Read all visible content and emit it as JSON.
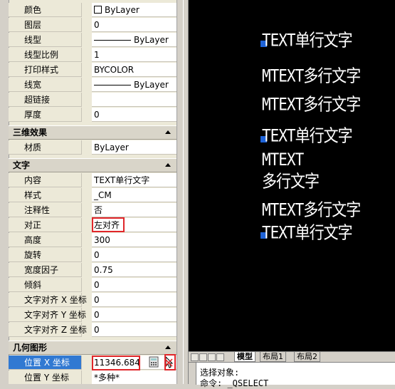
{
  "properties": {
    "general_rows": [
      {
        "label": "颜色",
        "value": "ByLayer"
      },
      {
        "label": "图层",
        "value": "0"
      },
      {
        "label": "线型",
        "value": "ByLayer"
      },
      {
        "label": "线型比例",
        "value": "1"
      },
      {
        "label": "打印样式",
        "value": "BYCOLOR"
      },
      {
        "label": "线宽",
        "value": "ByLayer"
      },
      {
        "label": "超链接",
        "value": ""
      },
      {
        "label": "厚度",
        "value": "0"
      }
    ],
    "section_3d": "三维效果",
    "rows_3d": [
      {
        "label": "材质",
        "value": "ByLayer"
      }
    ],
    "section_text": "文字",
    "text_rows": [
      {
        "label": "内容",
        "value": "TEXT单行文字"
      },
      {
        "label": "样式",
        "value": "_CM"
      },
      {
        "label": "注释性",
        "value": "否"
      },
      {
        "label": "对正",
        "value": "左对齐"
      },
      {
        "label": "高度",
        "value": "300"
      },
      {
        "label": "旋转",
        "value": "0"
      },
      {
        "label": "宽度因子",
        "value": "0.75"
      },
      {
        "label": "倾斜",
        "value": "0"
      },
      {
        "label": "文字对齐 X 坐标",
        "value": "0"
      },
      {
        "label": "文字对齐 Y 坐标",
        "value": "0"
      },
      {
        "label": "文字对齐 Z 坐标",
        "value": "0"
      }
    ],
    "section_geo": "几何图形",
    "geo_rows": [
      {
        "label": "位置 X 坐标",
        "value": "11346.684"
      },
      {
        "label": "位置 Y 坐标",
        "value": "*多种*"
      }
    ]
  },
  "drawing": {
    "texts": [
      "TEXT单行文字",
      "MTEXT多行文字",
      "MTEXT多行文字",
      "TEXT单行文字",
      "MTEXT",
      "多行文字",
      "MTEXT多行文字",
      "TEXT单行文字"
    ]
  },
  "layout_tabs": [
    "模型",
    "布局1",
    "布局2"
  ],
  "command_line": {
    "line1": "选择对象:",
    "line2": "命令:  _QSELECT"
  },
  "colors": {
    "canvas_bg": "#000000",
    "grip": "#1e63d8",
    "highlight_box": "#e0262a",
    "selected_row": "#3179d2"
  }
}
